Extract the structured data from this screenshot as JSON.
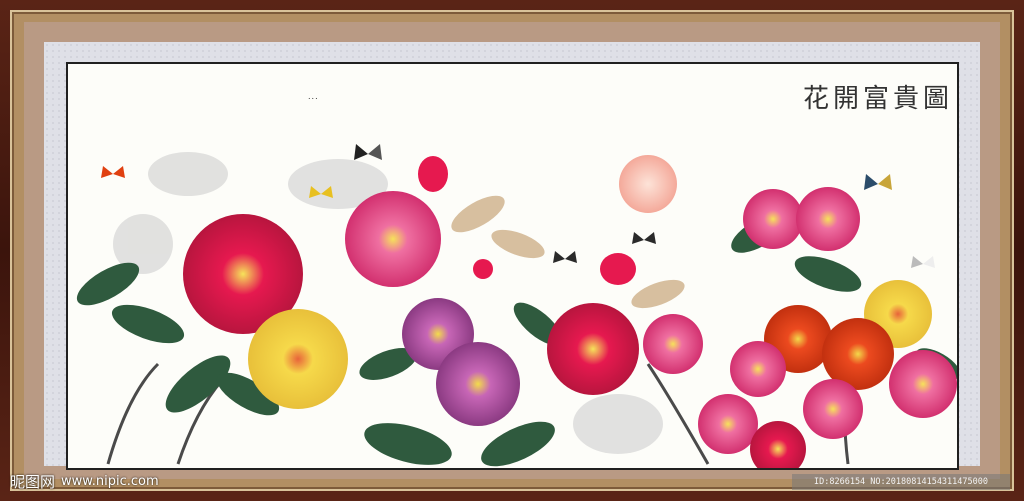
{
  "painting": {
    "title": "花開富貴圖",
    "inscription": "..."
  },
  "watermark": {
    "brand": "昵图网",
    "site": "www.nipic.com"
  },
  "id_bar": {
    "text": "ID:8266154 NO:20180814154311475000"
  },
  "colors": {
    "frame_outer": "#3b140c",
    "mat": "#b99a84",
    "sun": "#f5b8a8",
    "peony_red": "#e6194f",
    "peony_yellow": "#f3d43c",
    "peony_purple": "#a8489a",
    "peony_orange": "#e3421b",
    "leaf": "#2f5a3e"
  }
}
